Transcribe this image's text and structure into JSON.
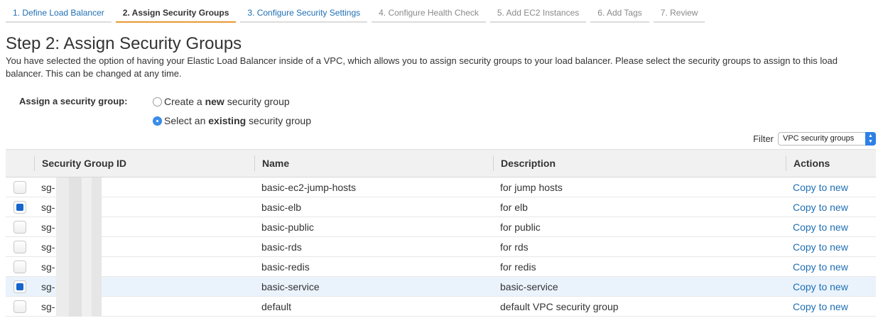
{
  "wizard": {
    "steps": [
      {
        "label": "1. Define Load Balancer",
        "state": "link"
      },
      {
        "label": "2. Assign Security Groups",
        "state": "active"
      },
      {
        "label": "3. Configure Security Settings",
        "state": "link"
      },
      {
        "label": "4. Configure Health Check",
        "state": "disabled"
      },
      {
        "label": "5. Add EC2 Instances",
        "state": "disabled"
      },
      {
        "label": "6. Add Tags",
        "state": "disabled"
      },
      {
        "label": "7. Review",
        "state": "disabled"
      }
    ]
  },
  "page": {
    "title": "Step 2: Assign Security Groups",
    "intro": "You have selected the option of having your Elastic Load Balancer inside of a VPC, which allows you to assign security groups to your load balancer. Please select the security groups to assign to this load balancer. This can be changed at any time."
  },
  "assign": {
    "label": "Assign a security group:",
    "option_new": {
      "prefix": "Create a ",
      "bold": "new",
      "suffix": " security group",
      "checked": false
    },
    "option_existing": {
      "prefix": "Select an ",
      "bold": "existing",
      "suffix": " security group",
      "checked": true
    }
  },
  "filter": {
    "label": "Filter",
    "selected": "VPC security groups"
  },
  "table": {
    "headers": {
      "id": "Security Group ID",
      "name": "Name",
      "description": "Description",
      "actions": "Actions"
    },
    "rows": [
      {
        "id_prefix": "sg-",
        "name": "basic-ec2-jump-hosts",
        "description": "for jump hosts",
        "action": "Copy to new",
        "checked": false
      },
      {
        "id_prefix": "sg-",
        "name": "basic-elb",
        "description": "for elb",
        "action": "Copy to new",
        "checked": true
      },
      {
        "id_prefix": "sg-",
        "name": "basic-public",
        "description": "for public",
        "action": "Copy to new",
        "checked": false
      },
      {
        "id_prefix": "sg-",
        "name": "basic-rds",
        "description": "for rds",
        "action": "Copy to new",
        "checked": false
      },
      {
        "id_prefix": "sg-",
        "name": "basic-redis",
        "description": "for redis",
        "action": "Copy to new",
        "checked": false
      },
      {
        "id_prefix": "sg-",
        "name": "basic-service",
        "description": "basic-service",
        "action": "Copy to new",
        "checked": true
      },
      {
        "id_prefix": "sg-",
        "name": "default",
        "description": "default VPC security group",
        "action": "Copy to new",
        "checked": false
      }
    ]
  },
  "colors": {
    "link": "#1f6fb4",
    "active_step_underline": "#e79a33",
    "selected_row": "#eaf3fc",
    "checkbox_fill": "#1765cc"
  }
}
